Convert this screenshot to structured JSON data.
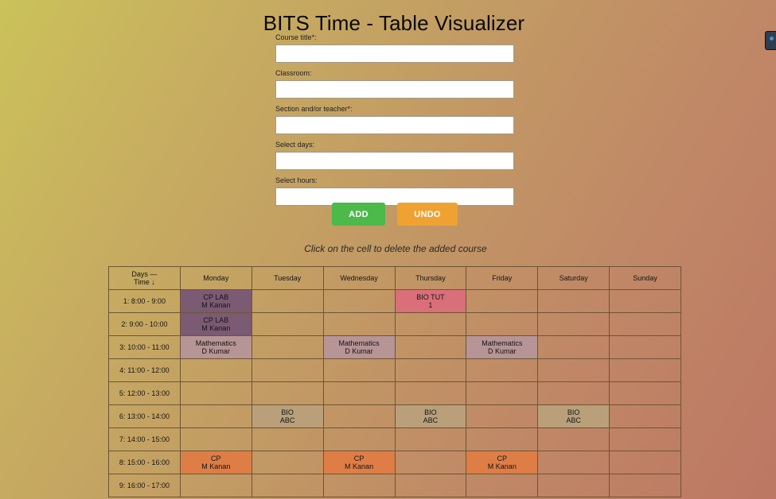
{
  "app": {
    "title": "BITS Time - Table Visualizer"
  },
  "form": {
    "fields": [
      {
        "label": "Course title*:",
        "value": ""
      },
      {
        "label": "Classroom:",
        "value": ""
      },
      {
        "label": "Section and/or teacher*:",
        "value": ""
      },
      {
        "label": "Select days:",
        "value": ""
      },
      {
        "label": "Select hours:",
        "value": ""
      }
    ],
    "add_label": "ADD",
    "undo_label": "UNDO"
  },
  "hint": "Click on the cell to delete the added course",
  "colors": {
    "add_button": "#4cb94b",
    "undo_button": "#efa232",
    "cp_lab": "#7b5a73",
    "mathematics": "#b79495",
    "bio_tut": "#d96f79",
    "bio": "#b9a07a",
    "cp": "#de7e46"
  },
  "timetable": {
    "corner_line1": "Days —",
    "corner_line2": "Time ↓",
    "days": [
      "Monday",
      "Tuesday",
      "Wednesday",
      "Thursday",
      "Friday",
      "Saturday",
      "Sunday"
    ],
    "rows": [
      {
        "time": "1: 8:00 - 9:00",
        "cells": [
          {
            "title": "CP LAB",
            "sub": "M Kanan",
            "kind": "lab"
          },
          null,
          null,
          {
            "title": "BIO TUT",
            "sub": "1",
            "kind": "biotut"
          },
          null,
          null,
          null
        ]
      },
      {
        "time": "2: 9:00 - 10:00",
        "cells": [
          {
            "title": "CP LAB",
            "sub": "M Kanan",
            "kind": "lab"
          },
          null,
          null,
          null,
          null,
          null,
          null
        ]
      },
      {
        "time": "3: 10:00 - 11:00",
        "cells": [
          {
            "title": "Mathematics",
            "sub": "D Kumar",
            "kind": "math"
          },
          null,
          {
            "title": "Mathematics",
            "sub": "D Kumar",
            "kind": "math"
          },
          null,
          {
            "title": "Mathematics",
            "sub": "D Kumar",
            "kind": "math"
          },
          null,
          null
        ]
      },
      {
        "time": "4: 11:00 - 12:00",
        "cells": [
          null,
          null,
          null,
          null,
          null,
          null,
          null
        ]
      },
      {
        "time": "5: 12:00 - 13:00",
        "cells": [
          null,
          null,
          null,
          null,
          null,
          null,
          null
        ]
      },
      {
        "time": "6: 13:00 - 14:00",
        "cells": [
          null,
          {
            "title": "BIO",
            "sub": "ABC",
            "kind": "bio"
          },
          null,
          {
            "title": "BIO",
            "sub": "ABC",
            "kind": "bio"
          },
          null,
          {
            "title": "BIO",
            "sub": "ABC",
            "kind": "bio"
          },
          null
        ]
      },
      {
        "time": "7: 14:00 - 15:00",
        "cells": [
          null,
          null,
          null,
          null,
          null,
          null,
          null
        ]
      },
      {
        "time": "8: 15:00 - 16:00",
        "cells": [
          {
            "title": "CP",
            "sub": "M Kanan",
            "kind": "cp"
          },
          null,
          {
            "title": "CP",
            "sub": "M Kanan",
            "kind": "cp"
          },
          null,
          {
            "title": "CP",
            "sub": "M Kanan",
            "kind": "cp"
          },
          null,
          null
        ]
      },
      {
        "time": "9: 16:00 - 17:00",
        "cells": [
          null,
          null,
          null,
          null,
          null,
          null,
          null
        ]
      }
    ]
  }
}
